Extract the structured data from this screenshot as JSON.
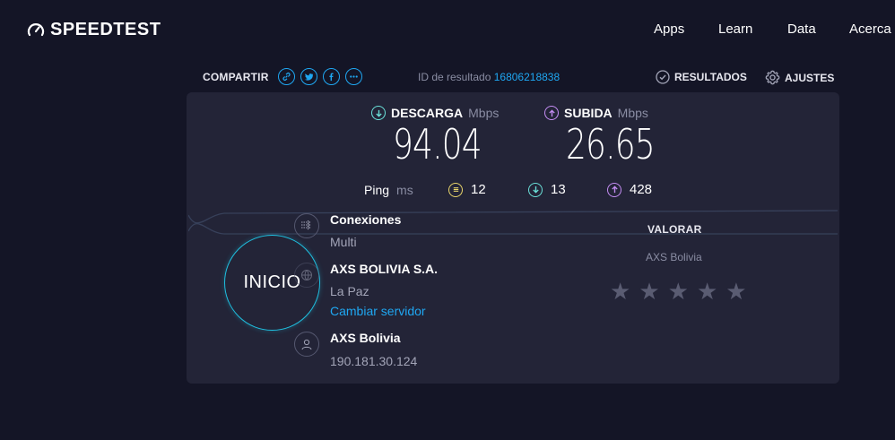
{
  "brand": {
    "name": "SPEEDTEST"
  },
  "nav": {
    "apps": "Apps",
    "learn": "Learn",
    "data": "Data",
    "about": "Acerca"
  },
  "share": {
    "label": "COMPARTIR"
  },
  "result": {
    "label": "ID de resultado",
    "id": "16806218838"
  },
  "actions": {
    "results": "RESULTADOS",
    "settings": "AJUSTES"
  },
  "download": {
    "label": "DESCARGA",
    "unit": "Mbps",
    "value": "94.04"
  },
  "upload": {
    "label": "SUBIDA",
    "unit": "Mbps",
    "value": "26.65"
  },
  "ping": {
    "label": "Ping",
    "unit": "ms",
    "idle": "12",
    "down": "13",
    "up": "428"
  },
  "start": {
    "label": "INICIO"
  },
  "connections": {
    "title": "Conexiones",
    "value": "Multi"
  },
  "server": {
    "name": "AXS BOLIVIA S.A.",
    "location": "La Paz",
    "change_link": "Cambiar servidor"
  },
  "isp": {
    "name": "AXS Bolivia",
    "ip": "190.181.30.124"
  },
  "rating": {
    "title": "VALORAR",
    "isp": "AXS Bolivia",
    "stars": 5
  },
  "colors": {
    "background": "#141526",
    "card": "#232437",
    "accent": "#1fa7f2",
    "download": "#6ae0d8",
    "upload": "#c38cf2",
    "ping": "#e8d46a"
  }
}
